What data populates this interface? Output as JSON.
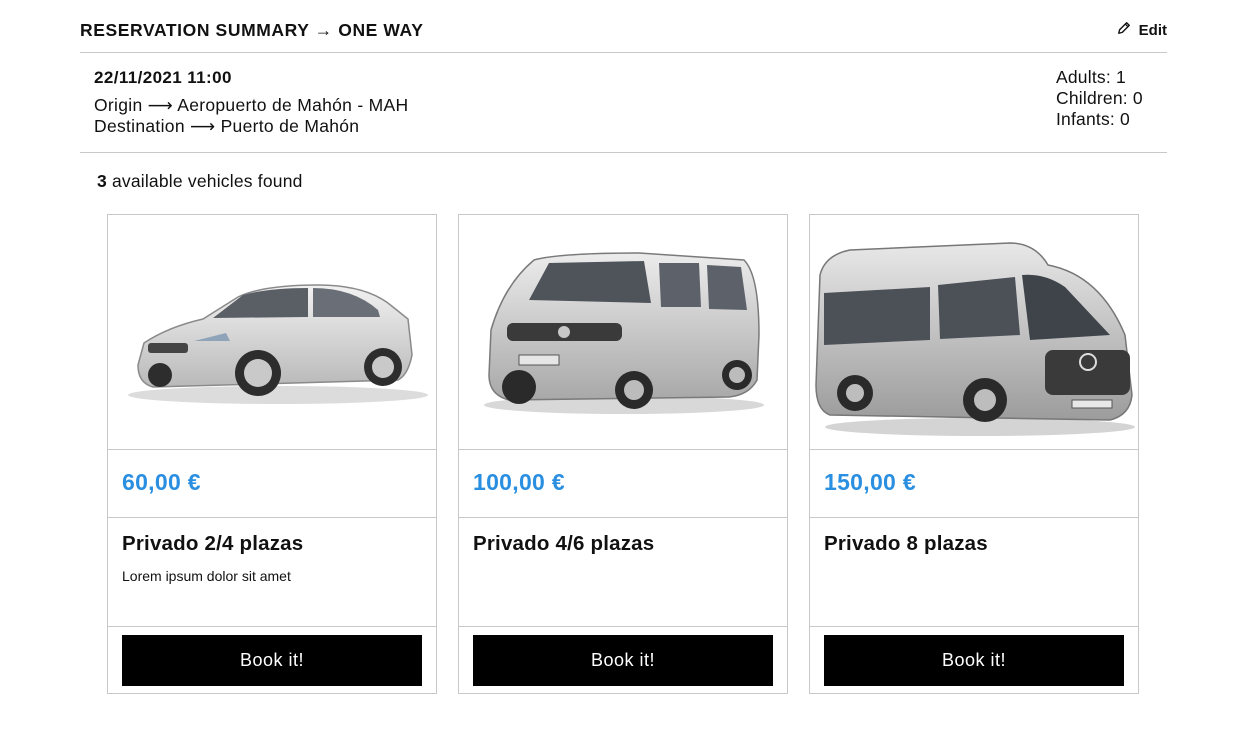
{
  "header": {
    "title": "RESERVATION SUMMARY → ONE WAY",
    "edit_label": "Edit",
    "edit_icon": "pencil-icon"
  },
  "summary": {
    "datetime": "22/11/2021 11:00",
    "origin": "Origin ⟶ Aeropuerto de Mahón - MAH",
    "destination": "Destination ⟶ Puerto de Mahón",
    "adults": "Adults: 1",
    "children": "Children: 0",
    "infants": "Infants: 0"
  },
  "results": {
    "count": "3",
    "label": "available vehicles found"
  },
  "vehicles": [
    {
      "image": "silver-sedan-car",
      "price": "60,00 €",
      "name": "Privado 2/4 plazas",
      "description": "Lorem ipsum dolor sit amet",
      "button": "Book it!"
    },
    {
      "image": "silver-nissan-van",
      "price": "100,00 €",
      "name": "Privado 4/6 plazas",
      "description": "",
      "button": "Book it!"
    },
    {
      "image": "silver-mercedes-minibus",
      "price": "150,00 €",
      "name": "Privado 8 plazas",
      "description": "",
      "button": "Book it!"
    }
  ],
  "colors": {
    "price": "#2a8fe0",
    "button_bg": "#000000",
    "button_text": "#ffffff",
    "border": "#c8c8c8"
  }
}
